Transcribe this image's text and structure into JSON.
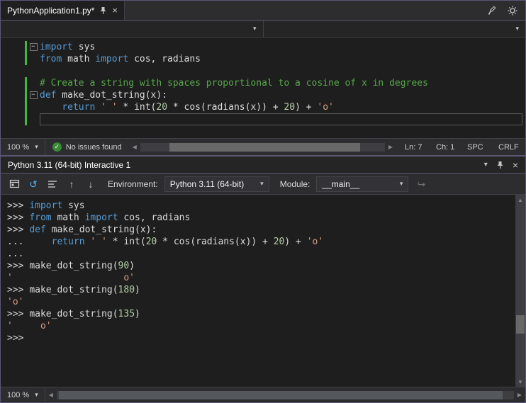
{
  "colors": {
    "keyword": "#569cd6",
    "string": "#d69d85",
    "number": "#b5cea8",
    "comment": "#57a64a",
    "plain": "#dcdcdc",
    "prompt": "#d4d4d4",
    "change_bar": "#45b53f",
    "check_green": "#388a34",
    "accent_border": "#5a5875"
  },
  "icons": {
    "chevron_down": "▾",
    "close": "×",
    "check": "✓",
    "scroll_left": "◀",
    "scroll_right": "▶",
    "scroll_up": "▲",
    "scroll_down": "▼",
    "reset": "↺",
    "history_previous": "↑",
    "history_next": "↓",
    "redo": "↪",
    "fold_collapse": "−"
  },
  "tab_bar": {
    "tab": {
      "label": "PythonApplication1.py*"
    }
  },
  "editor": {
    "lines": [
      {
        "fold": true,
        "change": true,
        "tokens": [
          {
            "c": "kw",
            "t": "import"
          },
          {
            "c": "pl",
            "t": " sys"
          }
        ]
      },
      {
        "change": true,
        "tokens": [
          {
            "c": "kw",
            "t": "from"
          },
          {
            "c": "pl",
            "t": " math "
          },
          {
            "c": "kw",
            "t": "import"
          },
          {
            "c": "pl",
            "t": " cos, radians"
          }
        ]
      },
      {
        "tokens": []
      },
      {
        "change": true,
        "tokens": [
          {
            "c": "cm",
            "t": "# Create a string with spaces proportional to a cosine of x in degrees"
          }
        ]
      },
      {
        "fold": true,
        "change": true,
        "tokens": [
          {
            "c": "kw",
            "t": "def"
          },
          {
            "c": "pl",
            "t": " make_dot_string(x):"
          }
        ]
      },
      {
        "change": true,
        "tokens": [
          {
            "c": "pl",
            "t": "    "
          },
          {
            "c": "kw",
            "t": "return"
          },
          {
            "c": "pl",
            "t": " "
          },
          {
            "c": "str",
            "t": "' '"
          },
          {
            "c": "pl",
            "t": " * int("
          },
          {
            "c": "num",
            "t": "20"
          },
          {
            "c": "pl",
            "t": " * cos(radians(x)) + "
          },
          {
            "c": "num",
            "t": "20"
          },
          {
            "c": "pl",
            "t": ") + "
          },
          {
            "c": "str",
            "t": "'o'"
          }
        ]
      },
      {
        "change": true,
        "current": true,
        "tokens": []
      }
    ]
  },
  "editor_status": {
    "zoom": "100 %",
    "issues": "No issues found",
    "line": "Ln: 7",
    "column": "Ch: 1",
    "insert_mode": "SPC",
    "line_ending": "CRLF"
  },
  "interactive": {
    "title": "Python 3.11 (64-bit) Interactive 1",
    "toolbar": {
      "environment_label": "Environment:",
      "environment_value": "Python 3.11 (64-bit)",
      "module_label": "Module:",
      "module_value": "__main__"
    },
    "lines": [
      {
        "tokens": [
          {
            "c": "pr",
            "t": ">>> "
          },
          {
            "c": "kw",
            "t": "import"
          },
          {
            "c": "pl",
            "t": " sys"
          }
        ]
      },
      {
        "tokens": [
          {
            "c": "pr",
            "t": ">>> "
          },
          {
            "c": "kw",
            "t": "from"
          },
          {
            "c": "pl",
            "t": " math "
          },
          {
            "c": "kw",
            "t": "import"
          },
          {
            "c": "pl",
            "t": " cos, radians"
          }
        ]
      },
      {
        "tokens": [
          {
            "c": "pr",
            "t": ">>> "
          },
          {
            "c": "kw",
            "t": "def"
          },
          {
            "c": "pl",
            "t": " make_dot_string(x):"
          }
        ]
      },
      {
        "tokens": [
          {
            "c": "pr",
            "t": "... "
          },
          {
            "c": "pl",
            "t": "    "
          },
          {
            "c": "kw",
            "t": "return"
          },
          {
            "c": "pl",
            "t": " "
          },
          {
            "c": "str",
            "t": "' '"
          },
          {
            "c": "pl",
            "t": " * int("
          },
          {
            "c": "num",
            "t": "20"
          },
          {
            "c": "pl",
            "t": " * cos(radians(x)) + "
          },
          {
            "c": "num",
            "t": "20"
          },
          {
            "c": "pl",
            "t": ") + "
          },
          {
            "c": "str",
            "t": "'o'"
          }
        ]
      },
      {
        "tokens": [
          {
            "c": "pr",
            "t": "... "
          }
        ]
      },
      {
        "tokens": [
          {
            "c": "pr",
            "t": ">>> "
          },
          {
            "c": "pl",
            "t": "make_dot_string("
          },
          {
            "c": "num",
            "t": "90"
          },
          {
            "c": "pl",
            "t": ")"
          }
        ]
      },
      {
        "tokens": [
          {
            "c": "str",
            "t": "'                    o'"
          }
        ]
      },
      {
        "tokens": [
          {
            "c": "pr",
            "t": ">>> "
          },
          {
            "c": "pl",
            "t": "make_dot_string("
          },
          {
            "c": "num",
            "t": "180"
          },
          {
            "c": "pl",
            "t": ")"
          }
        ]
      },
      {
        "tokens": [
          {
            "c": "str",
            "t": "'o'"
          }
        ]
      },
      {
        "tokens": [
          {
            "c": "pr",
            "t": ">>> "
          },
          {
            "c": "pl",
            "t": "make_dot_string("
          },
          {
            "c": "num",
            "t": "135"
          },
          {
            "c": "pl",
            "t": ")"
          }
        ]
      },
      {
        "tokens": [
          {
            "c": "str",
            "t": "'     o'"
          }
        ]
      },
      {
        "tokens": [
          {
            "c": "pr",
            "t": ">>> "
          }
        ]
      }
    ],
    "status": {
      "zoom": "100 %"
    }
  }
}
